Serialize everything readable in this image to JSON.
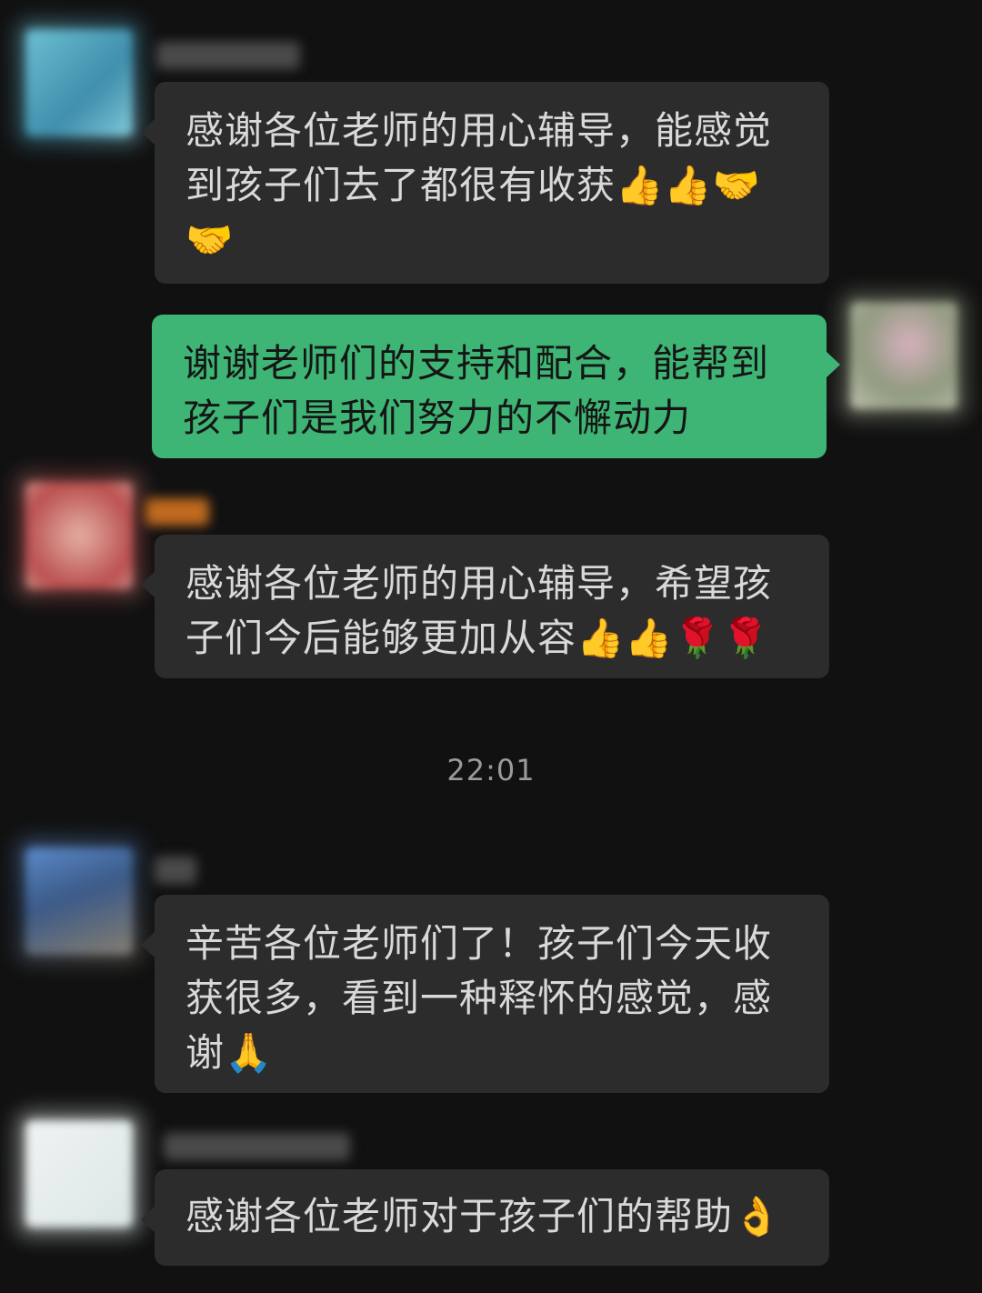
{
  "timestamp": "22:01",
  "messages": [
    {
      "side": "left",
      "text": "感谢各位老师的用心辅导，能感觉到孩子们去了都很有收获👍👍🤝🤝"
    },
    {
      "side": "right",
      "text": "谢谢老师们的支持和配合，能帮到孩子们是我们努力的不懈动力"
    },
    {
      "side": "left",
      "text": "感谢各位老师的用心辅导，希望孩子们今后能够更加从容👍👍🌹🌹"
    },
    {
      "side": "left",
      "text": "辛苦各位老师们了！孩子们今天收获很多，看到一种释怀的感觉，感谢🙏"
    },
    {
      "side": "left",
      "text": "感谢各位老师对于孩子们的帮助👌"
    }
  ],
  "colors": {
    "background": "#111111",
    "left_bubble": "#2c2c2c",
    "right_bubble": "#3eb575",
    "timestamp": "#9a9a9a"
  }
}
